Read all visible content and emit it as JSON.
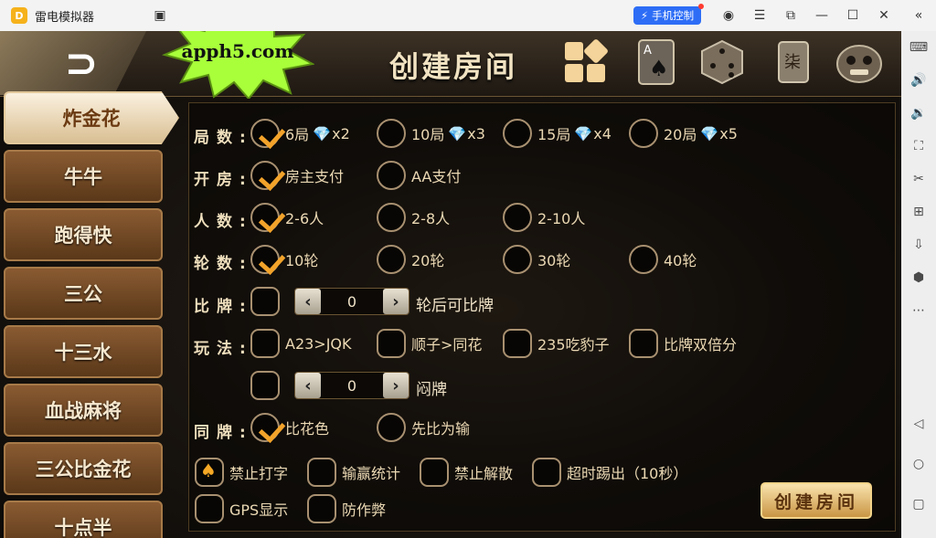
{
  "window": {
    "title": "雷电模拟器",
    "phone_control": "手机控制"
  },
  "game": {
    "page_title": "创建房间",
    "watermark": "apph5.com",
    "menu": [
      {
        "label": "炸金花",
        "active": true
      },
      {
        "label": "牛牛"
      },
      {
        "label": "跑得快"
      },
      {
        "label": "三公"
      },
      {
        "label": "十三水"
      },
      {
        "label": "血战麻将"
      },
      {
        "label": "三公比金花"
      },
      {
        "label": "十点半"
      }
    ],
    "rows": {
      "rounds": {
        "label": "局数:",
        "options": [
          {
            "text": "6局",
            "gem": "x2",
            "checked": true
          },
          {
            "text": "10局",
            "gem": "x3"
          },
          {
            "text": "15局",
            "gem": "x4"
          },
          {
            "text": "20局",
            "gem": "x5"
          }
        ]
      },
      "host": {
        "label": "开房:",
        "options": [
          {
            "text": "房主支付",
            "checked": true
          },
          {
            "text": "AA支付"
          }
        ]
      },
      "players": {
        "label": "人数:",
        "options": [
          {
            "text": "2-6人",
            "checked": true
          },
          {
            "text": "2-8人"
          },
          {
            "text": "2-10人"
          }
        ]
      },
      "turns": {
        "label": "轮数:",
        "options": [
          {
            "text": "10轮",
            "checked": true
          },
          {
            "text": "20轮"
          },
          {
            "text": "30轮"
          },
          {
            "text": "40轮"
          }
        ]
      },
      "compare": {
        "label": "比牌:",
        "stepper_value": "0",
        "suffix": "轮后可比牌"
      },
      "rules": {
        "label": "玩法:",
        "options": [
          {
            "text": "A23>JQK"
          },
          {
            "text": "顺子>同花"
          },
          {
            "text": "235吃豹子"
          },
          {
            "text": "比牌双倍分"
          }
        ],
        "stepper_value": "0",
        "suffix": "闷牌"
      },
      "same": {
        "label": "同牌:",
        "options": [
          {
            "text": "比花色",
            "checked": true
          },
          {
            "text": "先比为输"
          }
        ]
      },
      "extra": [
        {
          "text": "禁止打字",
          "checked": true
        },
        {
          "text": "输赢统计"
        },
        {
          "text": "禁止解散"
        },
        {
          "text": "超时踢出（10秒）"
        },
        {
          "text": "GPS显示"
        },
        {
          "text": "防作弊"
        }
      ]
    },
    "create_button": "创建房间"
  }
}
